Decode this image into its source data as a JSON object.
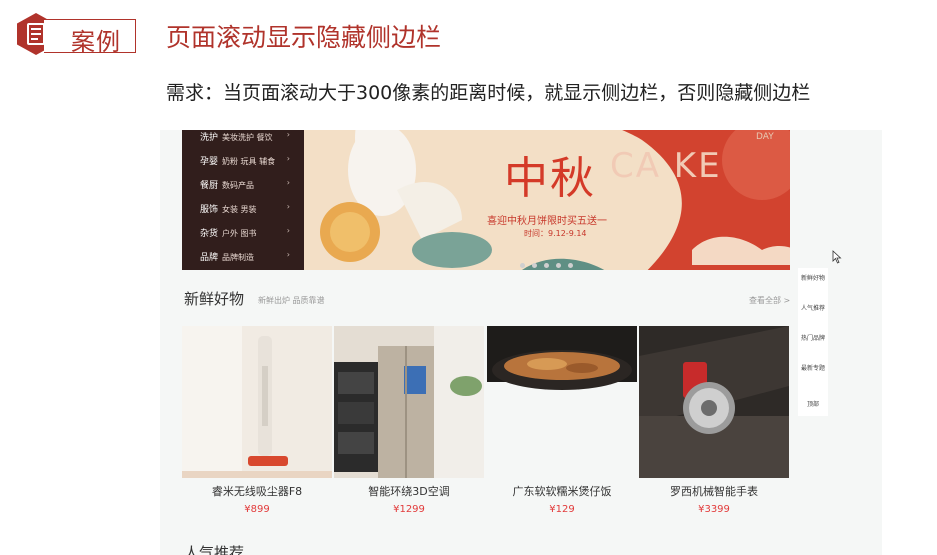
{
  "header": {
    "badge_label": "案例",
    "title": "页面滚动显示隐藏侧边栏",
    "requirement": "需求：当页面滚动大于300像素的距离时候，就显示侧边栏，否则隐藏侧边栏"
  },
  "screen": {
    "categories": [
      {
        "main": "洗护",
        "sub": "美妆洗护 餐饮"
      },
      {
        "main": "孕婴",
        "sub": "奶粉 玩具 辅食"
      },
      {
        "main": "餐厨",
        "sub": "数码产品"
      },
      {
        "main": "服饰",
        "sub": "女装 男装"
      },
      {
        "main": "杂货",
        "sub": "户外 图书"
      },
      {
        "main": "品牌",
        "sub": "品牌制造"
      }
    ],
    "banner": {
      "headline": "中秋",
      "subtitle": "喜迎中秋月饼限时买五送一",
      "date": "时间：9.12-9.14",
      "corner": "DAY",
      "deco_text": "CA KE"
    },
    "section": {
      "title": "新鲜好物",
      "subtitle": "新鲜出炉 品质靠谱",
      "more": "查看全部 >"
    },
    "products": [
      {
        "name": "睿米无线吸尘器F8",
        "price": "¥899"
      },
      {
        "name": "智能环绕3D空调",
        "price": "¥1299"
      },
      {
        "name": "广东软软糯米煲仔饭",
        "price": "¥129"
      },
      {
        "name": "罗西机械智能手表",
        "price": "¥3399"
      }
    ],
    "sidebar": [
      "新鲜好物",
      "人气推荐",
      "热门品牌",
      "最新专题",
      "顶部"
    ],
    "next_section_title": "人气推荐"
  },
  "colors": {
    "accent": "#b0332b",
    "price": "#e23b3b"
  }
}
